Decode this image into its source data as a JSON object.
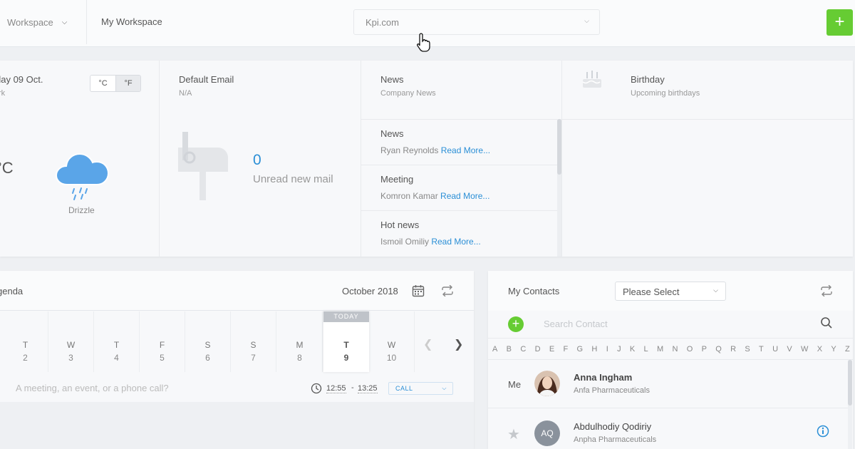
{
  "topbar": {
    "workspace_select": "Workspace",
    "workspace_title": "My Workspace",
    "domain_select": "Kpi.com",
    "add_label": "+"
  },
  "weather": {
    "date": "day 09 Oct.",
    "location": "rk",
    "unit_c": "°C",
    "unit_f": "°F",
    "temperature": "°C",
    "condition": "Drizzle"
  },
  "email": {
    "title": "Default Email",
    "address": "N/A",
    "count": "0",
    "count_label": "Unread new mail"
  },
  "news": {
    "title": "News",
    "subtitle": "Company News",
    "read_more": "Read More...",
    "items": [
      {
        "title": "News",
        "author": "Ryan Reynolds"
      },
      {
        "title": "Meeting",
        "author": "Komron Kamar"
      },
      {
        "title": "Hot news",
        "author": "Ismoil Omiliy"
      }
    ]
  },
  "birthday": {
    "title": "Birthday",
    "subtitle": "Upcoming birthdays"
  },
  "agenda": {
    "title": "genda",
    "month": "October 2018",
    "today_badge": "TODAY",
    "days": [
      {
        "name": "T",
        "date": "2"
      },
      {
        "name": "W",
        "date": "3"
      },
      {
        "name": "T",
        "date": "4"
      },
      {
        "name": "F",
        "date": "5"
      },
      {
        "name": "S",
        "date": "6"
      },
      {
        "name": "S",
        "date": "7"
      },
      {
        "name": "M",
        "date": "8"
      },
      {
        "name": "T",
        "date": "9"
      },
      {
        "name": "W",
        "date": "10"
      }
    ],
    "event_placeholder": "A meeting, an event, or a phone call?",
    "time_start": "12:55",
    "time_sep": "-",
    "time_end": "13:25",
    "type_select": "CALL"
  },
  "contacts": {
    "title": "My Contacts",
    "filter_select": "Please Select",
    "add_label": "+",
    "search_placeholder": "Search Contact",
    "alphabet": [
      "A",
      "B",
      "C",
      "D",
      "E",
      "F",
      "G",
      "H",
      "I",
      "J",
      "K",
      "L",
      "M",
      "N",
      "O",
      "P",
      "Q",
      "R",
      "S",
      "T",
      "U",
      "V",
      "W",
      "X",
      "Y",
      "Z"
    ],
    "me_label": "Me",
    "list": [
      {
        "name": "Anna Ingham",
        "company": "Anfa Pharmaceuticals"
      },
      {
        "name": "Abdulhodiy Qodiriy",
        "company": "Anpha Pharmaceuticals",
        "initials": "AQ"
      }
    ]
  },
  "colors": {
    "accent_green": "#66cc33",
    "link_blue": "#2b8fd6",
    "cloud_blue": "#5aa5e8"
  },
  "icons": [
    "chevron-down-icon",
    "hand-cursor-icon",
    "plus-icon",
    "cloud-rain-icon",
    "mailbox-icon",
    "birthday-cake-icon",
    "calendar-icon",
    "refresh-icon",
    "chevron-left-icon",
    "chevron-right-icon",
    "clock-icon",
    "search-icon",
    "star-icon",
    "info-icon"
  ]
}
